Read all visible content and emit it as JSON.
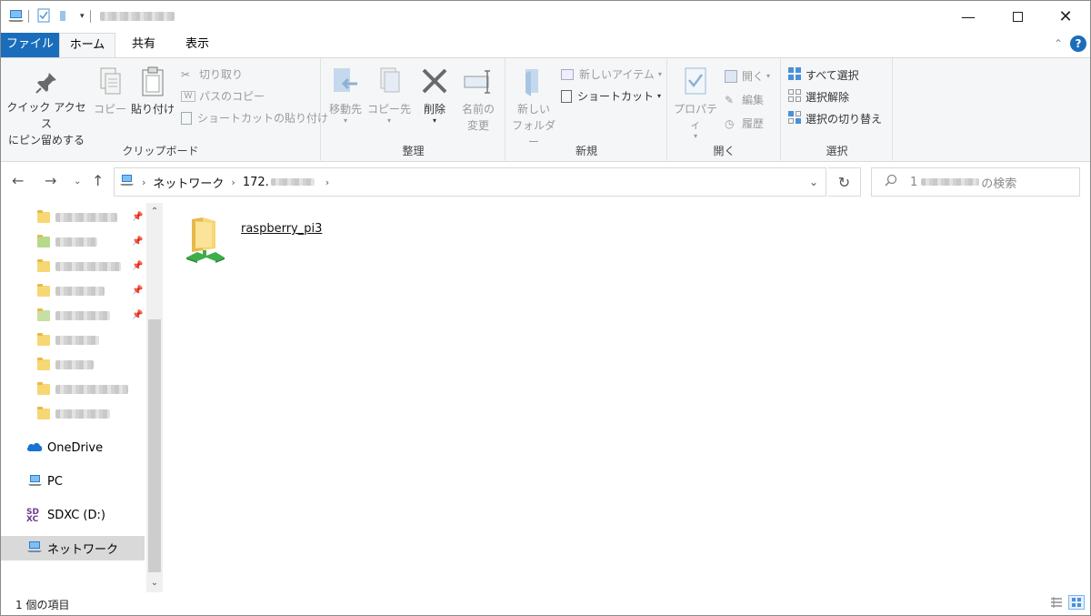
{
  "tabs": {
    "file": "ファイル",
    "home": "ホーム",
    "share": "共有",
    "view": "表示"
  },
  "ribbon": {
    "clipboard": {
      "label": "クリップボード",
      "pin_quick_access": [
        "クイック アクセス",
        "にピン留めする"
      ],
      "copy": "コピー",
      "paste": "貼り付け",
      "cut": "切り取り",
      "copy_path": "パスのコピー",
      "paste_shortcut": "ショートカットの貼り付け"
    },
    "organize": {
      "label": "整理",
      "move_to": "移動先",
      "copy_to": "コピー先",
      "delete": "削除",
      "rename": [
        "名前の",
        "変更"
      ]
    },
    "new": {
      "label": "新規",
      "new_folder": [
        "新しい",
        "フォルダー"
      ],
      "new_item": "新しいアイテム",
      "shortcut": "ショートカット"
    },
    "open": {
      "label": "開く",
      "properties": "プロパティ",
      "open": "開く",
      "edit": "編集",
      "history": "履歴"
    },
    "select": {
      "label": "選択",
      "select_all": "すべて選択",
      "select_none": "選択解除",
      "invert": "選択の切り替え"
    }
  },
  "address": {
    "crumb_network": "ネットワーク",
    "crumb_host": "172."
  },
  "search": {
    "prefix": "1",
    "suffix": "の検索"
  },
  "nav": {
    "onedrive": "OneDrive",
    "pc": "PC",
    "sdxc": "SDXC (D:)",
    "network": "ネットワーク"
  },
  "content": {
    "item_name": "raspberry_pi3"
  },
  "status": {
    "count": "1 個の項目"
  },
  "colors": {
    "accent": "#1a6dbb",
    "selected_nav": "#d9d9d9"
  }
}
